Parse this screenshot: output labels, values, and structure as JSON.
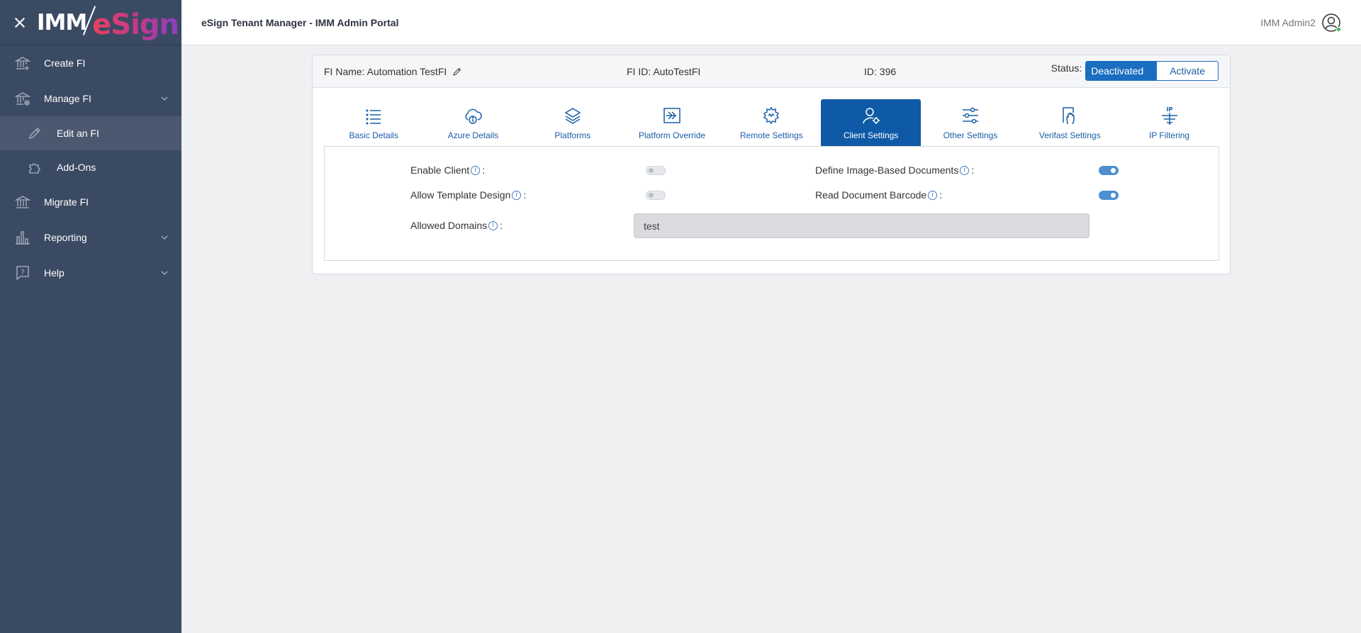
{
  "brand": {
    "part1": "IMM",
    "part2": "eSign"
  },
  "sidebar": {
    "items": [
      {
        "label": "Create FI",
        "icon": "bank-icon"
      },
      {
        "label": "Manage FI",
        "icon": "bank-settings-icon"
      },
      {
        "label": "Migrate FI",
        "icon": "bank-icon"
      },
      {
        "label": "Reporting",
        "icon": "bar-chart-icon"
      },
      {
        "label": "Help",
        "icon": "help-bubble-icon"
      }
    ],
    "subitems": [
      {
        "label": "Edit an FI",
        "icon": "pencil-icon"
      },
      {
        "label": "Add-Ons",
        "icon": "puzzle-icon"
      }
    ]
  },
  "header": {
    "title": "eSign Tenant Manager - IMM Admin Portal",
    "user": "IMM Admin2"
  },
  "fi": {
    "name_text": "FI Name: Automation TestFI",
    "fi_id_text": "FI ID: AutoTestFI",
    "id_text": "ID: 396",
    "status_label": "Status:",
    "status_deactivated": "Deactivated",
    "status_activate": "Activate"
  },
  "tabs": [
    {
      "label": "Basic Details",
      "icon": "list-icon"
    },
    {
      "label": "Azure Details",
      "icon": "cloud-info-icon"
    },
    {
      "label": "Platforms",
      "icon": "layers-icon"
    },
    {
      "label": "Platform Override",
      "icon": "override-arrow-icon"
    },
    {
      "label": "Remote Settings",
      "icon": "remote-gear-icon"
    },
    {
      "label": "Client Settings",
      "icon": "user-gear-icon",
      "active": true
    },
    {
      "label": "Other Settings",
      "icon": "sliders-icon"
    },
    {
      "label": "Verifast Settings",
      "icon": "hand-document-icon"
    },
    {
      "label": "IP Filtering",
      "icon": "ip-filter-icon"
    }
  ],
  "client_settings": {
    "enable_client": {
      "label": "Enable Client",
      "enabled": false
    },
    "allow_template_design": {
      "label": "Allow Template Design",
      "enabled": false
    },
    "define_image_based_documents": {
      "label": "Define Image-Based Documents",
      "enabled": true
    },
    "read_document_barcode": {
      "label": "Read Document Barcode",
      "enabled": true
    },
    "allowed_domains": {
      "label": "Allowed Domains",
      "value": "test"
    },
    "separator": ":"
  },
  "colors": {
    "sidebar": "#3b4a63",
    "accent": "#0f5aa6",
    "toggle_on": "#4d8fd0"
  }
}
